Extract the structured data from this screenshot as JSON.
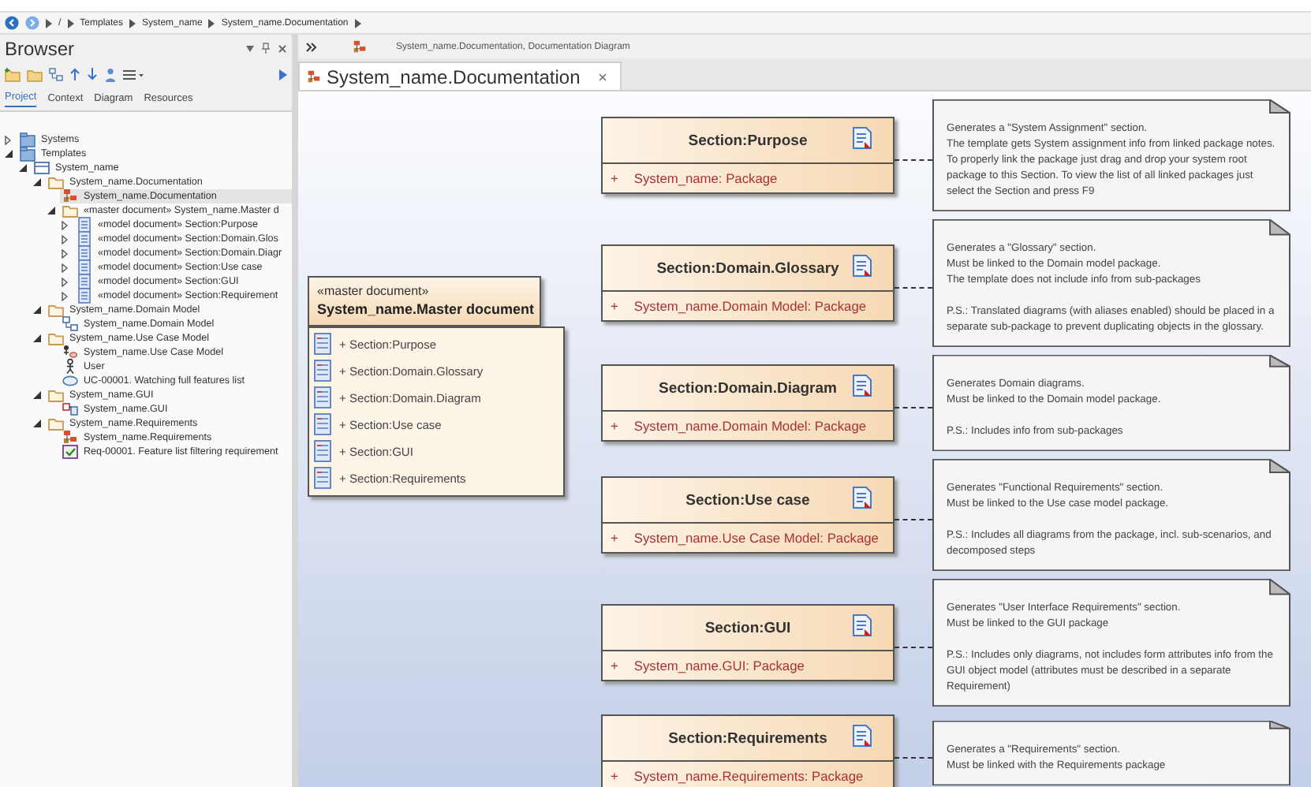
{
  "breadcrumb": [
    "/",
    "Templates",
    "System_name",
    "System_name.Documentation"
  ],
  "browser": {
    "title": "Browser",
    "tabs": [
      {
        "label": "Project",
        "selected": true
      },
      {
        "label": "Context",
        "selected": false
      },
      {
        "label": "Diagram",
        "selected": false
      },
      {
        "label": "Resources",
        "selected": false
      }
    ],
    "tree": [
      {
        "label": "Systems",
        "kind": "model",
        "expanded": false,
        "selected": false
      },
      {
        "label": "Templates",
        "kind": "model",
        "expanded": true,
        "selected": false,
        "children": [
          {
            "label": "System_name",
            "kind": "view",
            "expanded": true,
            "selected": false,
            "children": [
              {
                "label": "System_name.Documentation",
                "kind": "package",
                "expanded": true,
                "selected": false,
                "children": [
                  {
                    "label": "System_name.Documentation",
                    "kind": "diagram",
                    "selected": true
                  },
                  {
                    "label": "«master document» System_name.Master d",
                    "kind": "package",
                    "expanded": true,
                    "selected": false,
                    "children": [
                      {
                        "label": "«model document» Section:Purpose",
                        "kind": "document",
                        "expanded": false,
                        "selected": false
                      },
                      {
                        "label": "«model document» Section:Domain.Glos",
                        "kind": "document",
                        "expanded": false,
                        "selected": false
                      },
                      {
                        "label": "«model document» Section:Domain.Diagr",
                        "kind": "document",
                        "expanded": false,
                        "selected": false
                      },
                      {
                        "label": "«model document» Section:Use case",
                        "kind": "document",
                        "expanded": false,
                        "selected": false
                      },
                      {
                        "label": "«model document» Section:GUI",
                        "kind": "document",
                        "expanded": false,
                        "selected": false
                      },
                      {
                        "label": "«model document» Section:Requirement",
                        "kind": "document",
                        "expanded": false,
                        "selected": false
                      }
                    ]
                  }
                ]
              },
              {
                "label": "System_name.Domain Model",
                "kind": "package",
                "expanded": true,
                "selected": false,
                "children": [
                  {
                    "label": "System_name.Domain Model",
                    "kind": "class-diagram",
                    "selected": false
                  }
                ]
              },
              {
                "label": "System_name.Use Case Model",
                "kind": "package",
                "expanded": true,
                "selected": false,
                "children": [
                  {
                    "label": "System_name.Use Case Model",
                    "kind": "usecase-diagram",
                    "selected": false
                  },
                  {
                    "label": "User",
                    "kind": "actor",
                    "selected": false
                  },
                  {
                    "label": "UC-00001. Watching full features list",
                    "kind": "usecase",
                    "selected": false
                  }
                ]
              },
              {
                "label": "System_name.GUI",
                "kind": "package",
                "expanded": true,
                "selected": false,
                "children": [
                  {
                    "label": "System_name.GUI",
                    "kind": "gui-diagram",
                    "selected": false
                  }
                ]
              },
              {
                "label": "System_name.Requirements",
                "kind": "package",
                "expanded": true,
                "selected": false,
                "children": [
                  {
                    "label": "System_name.Requirements",
                    "kind": "diagram",
                    "selected": false
                  },
                  {
                    "label": "Req-00001. Feature list filtering requirement",
                    "kind": "requirement",
                    "selected": false
                  }
                ]
              }
            ]
          }
        ]
      }
    ]
  },
  "diagram_header": "System_name.Documentation,  Documentation Diagram",
  "tab": {
    "label": "System_name.Documentation"
  },
  "master": {
    "stereotype": "«master document»",
    "name": "System_name.Master document",
    "items": [
      "+ Section:Purpose",
      "+ Section:Domain.Glossary",
      "+ Section:Domain.Diagram",
      "+ Section:Use case",
      "+ Section:GUI",
      "+ Section:Requirements"
    ]
  },
  "sections": [
    {
      "title": "Section:Purpose",
      "visibility": "+",
      "attribute": "System_name: Package",
      "note": [
        [
          "Generates a \"System Assignment\" section.",
          "The template gets System assignment info from linked package notes. To properly link the package just drag and drop your system root package to this Section. To view the list of all linked packages just select the Section and press F9"
        ]
      ]
    },
    {
      "title": "Section:Domain.Glossary",
      "visibility": "+",
      "attribute": "System_name.Domain Model: Package",
      "note": [
        [
          "Generates a \"Glossary\" section.",
          "Must be linked to the Domain model package.",
          "The template does not include info from sub-packages"
        ],
        [
          "P.S.: Translated diagrams (with aliases enabled) should be placed in a separate sub-package to prevent duplicating objects in the glossary."
        ]
      ]
    },
    {
      "title": "Section:Domain.Diagram",
      "visibility": "+",
      "attribute": "System_name.Domain Model: Package",
      "note": [
        [
          "Generates Domain diagrams.",
          "Must be linked to the Domain model package."
        ],
        [
          "P.S.: Includes info from sub-packages"
        ]
      ]
    },
    {
      "title": "Section:Use case",
      "visibility": "+",
      "attribute": "System_name.Use Case Model: Package",
      "note": [
        [
          "Generates \"Functional Requirements\" section.",
          "Must be linked to the Use case model package."
        ],
        [
          "P.S.: Includes all diagrams from the package, incl. sub-scenarios, and decomposed steps"
        ]
      ]
    },
    {
      "title": "Section:GUI",
      "visibility": "+",
      "attribute": "System_name.GUI: Package",
      "note": [
        [
          "Generates  \"User Interface Requirements\" section.",
          "Must be linked to the GUI package"
        ],
        [
          "P.S.: Includes only diagrams, not includes form attributes info from the GUI object model (attributes must be described in a separate Requirement)"
        ]
      ]
    },
    {
      "title": "Section:Requirements",
      "visibility": "+",
      "attribute": "System_name.Requirements: Package",
      "note": [
        [
          "Generates a \"Requirements\" section.",
          "Must be linked with the Requirements package"
        ]
      ]
    }
  ]
}
